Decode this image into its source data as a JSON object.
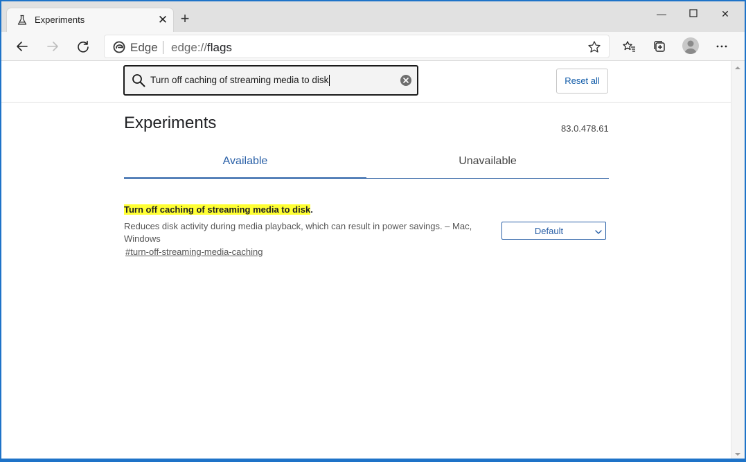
{
  "tab": {
    "title": "Experiments"
  },
  "address": {
    "site_name": "Edge",
    "url_scheme": "edge://",
    "url_host": "flags"
  },
  "search": {
    "value": "Turn off caching of streaming media to disk"
  },
  "header": {
    "reset_label": "Reset all"
  },
  "page": {
    "title": "Experiments",
    "version": "83.0.478.61"
  },
  "tabs": {
    "available": "Available",
    "unavailable": "Unavailable"
  },
  "flag": {
    "title_highlight": "Turn off caching of streaming media to disk",
    "title_suffix": ".",
    "description": "Reduces disk activity during media playback, which can result in power savings. – Mac, Windows",
    "link": "#turn-off-streaming-media-caching",
    "selected": "Default"
  },
  "colors": {
    "accent": "#275ea6",
    "highlight": "#ffff33",
    "frame": "#1e73c8"
  },
  "icons": [
    "flask-icon",
    "close-icon",
    "plus-icon",
    "minimize-icon",
    "maximize-icon",
    "window-close-icon",
    "back-icon",
    "forward-icon",
    "refresh-icon",
    "edge-logo-icon",
    "star-icon",
    "favorites-icon",
    "collections-icon",
    "profile-icon",
    "more-icon",
    "search-icon",
    "clear-icon",
    "chevron-down-icon"
  ]
}
